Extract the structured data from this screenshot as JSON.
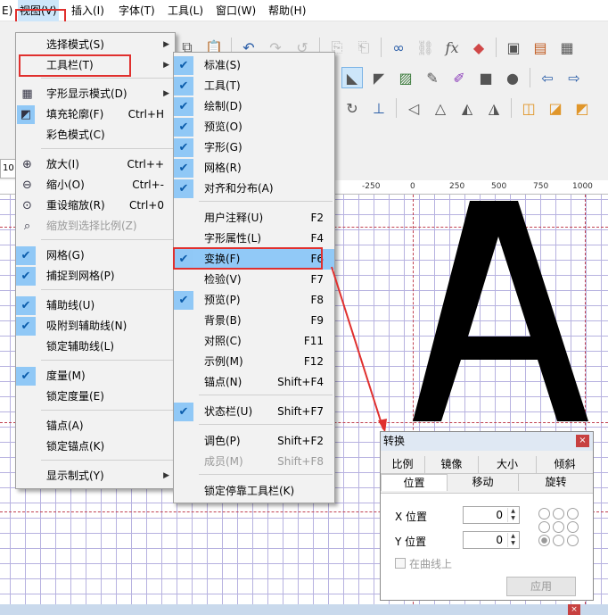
{
  "menubar": {
    "items": [
      "E)",
      "视图(V)",
      "插入(I)",
      "字体(T)",
      "工具(L)",
      "窗口(W)",
      "帮助(H)"
    ]
  },
  "zoom_field": "10",
  "ruler": {
    "ticks": [
      "-250",
      "0",
      "250",
      "500",
      "750",
      "1000"
    ]
  },
  "glyph_char": "A",
  "view_menu": {
    "items": [
      {
        "label": "选择模式(S)",
        "shortcut": "",
        "submenu": true
      },
      {
        "label": "工具栏(T)",
        "shortcut": "",
        "submenu": true
      },
      {
        "label": "字形显示模式(D)",
        "shortcut": "",
        "submenu": true,
        "icon": "glyph-mode-icon"
      },
      {
        "label": "填充轮廓(F)",
        "shortcut": "Ctrl+H",
        "checked_icon": "fill-outline-icon"
      },
      {
        "label": "彩色模式(C)",
        "shortcut": ""
      },
      {
        "label": "放大(I)",
        "shortcut": "Ctrl++",
        "icon": "zoom-in-icon"
      },
      {
        "label": "缩小(O)",
        "shortcut": "Ctrl+-",
        "icon": "zoom-out-icon"
      },
      {
        "label": "重设缩放(R)",
        "shortcut": "Ctrl+0",
        "icon": "reset-zoom-icon"
      },
      {
        "label": "缩放到选择比例(Z)",
        "shortcut": "",
        "disabled": true,
        "icon": "zoom-selection-icon"
      },
      {
        "label": "网格(G)",
        "shortcut": "",
        "checked": true
      },
      {
        "label": "捕捉到网格(P)",
        "shortcut": "",
        "checked": true
      },
      {
        "label": "辅助线(U)",
        "shortcut": "",
        "checked": true
      },
      {
        "label": "吸附到辅助线(N)",
        "shortcut": "",
        "checked": true
      },
      {
        "label": "锁定辅助线(L)",
        "shortcut": ""
      },
      {
        "label": "度量(M)",
        "shortcut": "",
        "checked": true
      },
      {
        "label": "锁定度量(E)",
        "shortcut": ""
      },
      {
        "label": "锚点(A)",
        "shortcut": ""
      },
      {
        "label": "锁定锚点(K)",
        "shortcut": ""
      },
      {
        "label": "显示制式(Y)",
        "shortcut": "",
        "submenu": true
      }
    ]
  },
  "toolbar_menu": {
    "items": [
      {
        "label": "标准(S)",
        "shortcut": "",
        "checked": true
      },
      {
        "label": "工具(T)",
        "shortcut": "",
        "checked": true
      },
      {
        "label": "绘制(D)",
        "shortcut": "",
        "checked": true
      },
      {
        "label": "预览(O)",
        "shortcut": "",
        "checked": true
      },
      {
        "label": "字形(G)",
        "shortcut": "",
        "checked": true
      },
      {
        "label": "网格(R)",
        "shortcut": "",
        "checked": true
      },
      {
        "label": "对齐和分布(A)",
        "shortcut": "",
        "checked": true
      },
      {
        "label": "用户注释(U)",
        "shortcut": "F2"
      },
      {
        "label": "字形属性(L)",
        "shortcut": "F4"
      },
      {
        "label": "变换(F)",
        "shortcut": "F6",
        "checked": true,
        "highlighted": true
      },
      {
        "label": "检验(V)",
        "shortcut": "F7"
      },
      {
        "label": "预览(P)",
        "shortcut": "F8",
        "checked": true
      },
      {
        "label": "背景(B)",
        "shortcut": "F9"
      },
      {
        "label": "对照(C)",
        "shortcut": "F11"
      },
      {
        "label": "示例(M)",
        "shortcut": "F12"
      },
      {
        "label": "锚点(N)",
        "shortcut": "Shift+F4"
      },
      {
        "label": "状态栏(U)",
        "shortcut": "Shift+F7",
        "checked": true
      },
      {
        "label": "调色(P)",
        "shortcut": "Shift+F2"
      },
      {
        "label": "成员(M)",
        "shortcut": "Shift+F8",
        "disabled": true
      },
      {
        "label": "锁定停靠工具栏(K)",
        "shortcut": ""
      }
    ]
  },
  "transform_dialog": {
    "title": "转换",
    "close": "×",
    "tabs_row1": [
      "比例",
      "镜像",
      "大小",
      "倾斜"
    ],
    "tabs_row2": [
      "位置",
      "移动",
      "旋转"
    ],
    "x_label": "X 位置",
    "x_value": "0",
    "y_label": "Y 位置",
    "y_value": "0",
    "on_curve_label": "在曲线上",
    "apply_label": "应用"
  },
  "colors": {
    "accent": "#e0302e",
    "highlight": "#91c9f7",
    "grid": "#b7b2e0"
  }
}
